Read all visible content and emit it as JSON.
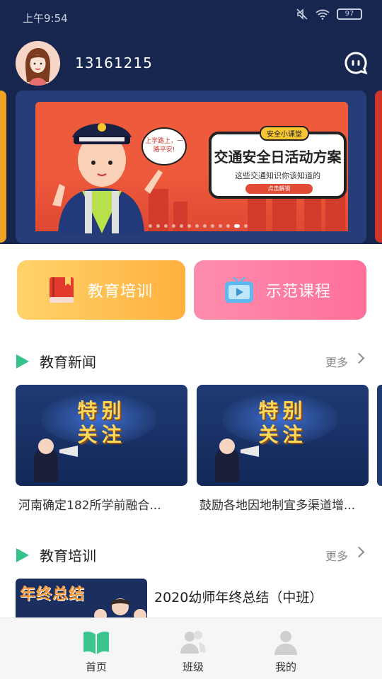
{
  "status_bar": {
    "time": "上午9:54",
    "battery": "97"
  },
  "profile": {
    "username": "13161215"
  },
  "banner": {
    "tag": "安全小课堂",
    "title": "交通安全日活动方案",
    "subtitle": "这些交通知识你该知道的",
    "button": "点击解锁",
    "bubble": "上学路上，一路平安!"
  },
  "quick_actions": [
    {
      "label": "教育培训"
    },
    {
      "label": "示范课程"
    }
  ],
  "news_section": {
    "title": "教育新闻",
    "more": "更多",
    "items": [
      {
        "image_text_1": "特别",
        "image_text_2": "关注",
        "title": "河南确定182所学前融合..."
      },
      {
        "image_text_1": "特别",
        "image_text_2": "关注",
        "title": "鼓励各地因地制宜多渠道增..."
      }
    ]
  },
  "training_section": {
    "title": "教育培训",
    "more": "更多",
    "items": [
      {
        "thumb_text": "年终总结",
        "title": "2020幼师年终总结（中班）"
      }
    ]
  },
  "tabbar": {
    "items": [
      {
        "label": "首页",
        "icon": "book-icon",
        "active": true
      },
      {
        "label": "班级",
        "icon": "people-icon",
        "active": false
      },
      {
        "label": "我的",
        "icon": "user-icon",
        "active": false
      }
    ]
  },
  "colors": {
    "header_bg": "#16264f",
    "accent_green": "#35c28b",
    "orange_button": "#ffb03f",
    "pink_button": "#ff6f9a"
  }
}
